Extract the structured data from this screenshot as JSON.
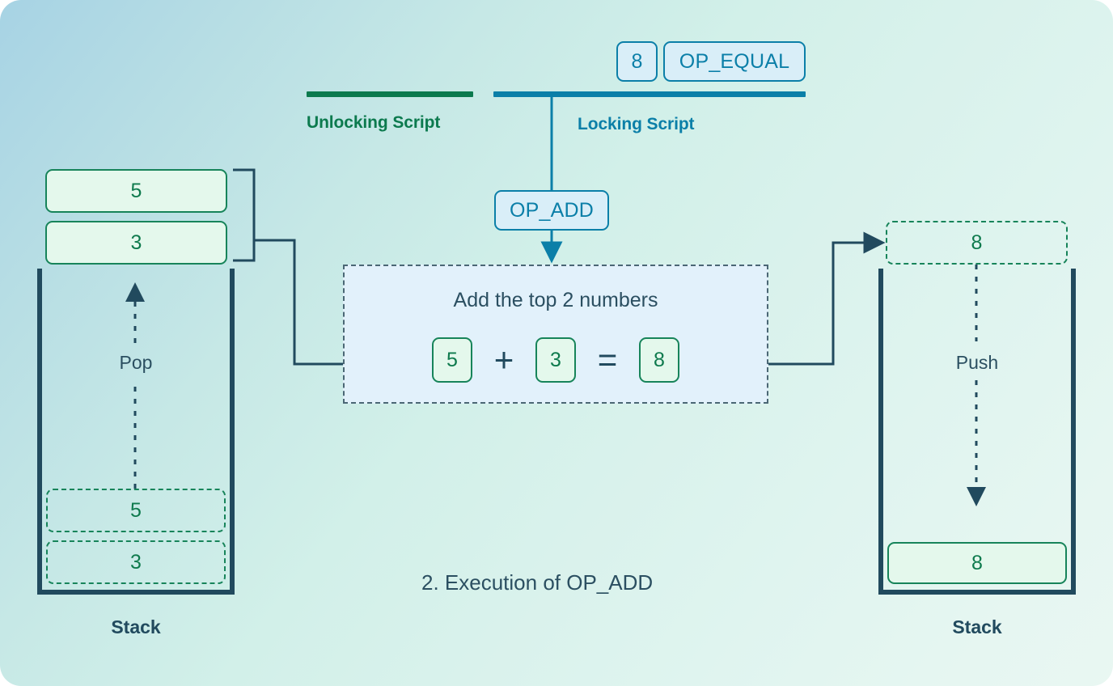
{
  "figure": {
    "caption": "2. Execution of OP_ADD",
    "background_from": "#a7d3e4",
    "background_to": "#e9f7f2"
  },
  "scripts": {
    "unlocking": {
      "label": "Unlocking Script",
      "color": "#0c7a4e",
      "bar_color": "#0c7a4e"
    },
    "locking": {
      "label": "Locking Script",
      "color": "#0b7fa8",
      "bar_color": "#0b7fa8",
      "items": [
        {
          "text": "8",
          "name": "op-chip-8"
        },
        {
          "text": "OP_EQUAL",
          "name": "op-chip-op-equal"
        }
      ]
    },
    "current_opcode": {
      "text": "OP_ADD",
      "name": "op-chip-op-add"
    }
  },
  "left_stack": {
    "caption": "Stack",
    "flow_label": "Pop",
    "popped_items": [
      {
        "value": "5"
      },
      {
        "value": "3"
      }
    ],
    "ghost_items": [
      {
        "value": "5"
      },
      {
        "value": "3"
      }
    ]
  },
  "right_stack": {
    "caption": "Stack",
    "flow_label": "Push",
    "incoming_item": {
      "value": "8"
    },
    "stack_items": [
      {
        "value": "8"
      }
    ]
  },
  "calculation": {
    "title": "Add the top 2 numbers",
    "operand_a": "5",
    "operator": "+",
    "operand_b": "3",
    "equals": "=",
    "result": "8"
  },
  "colors": {
    "ink": "#214a5e",
    "green": "#0e7a4d",
    "teal": "#0b7fa8",
    "green_fill": "#e4f8ec",
    "blue_fill": "#d9eef8",
    "panel_fill": "#e2f1fb"
  }
}
